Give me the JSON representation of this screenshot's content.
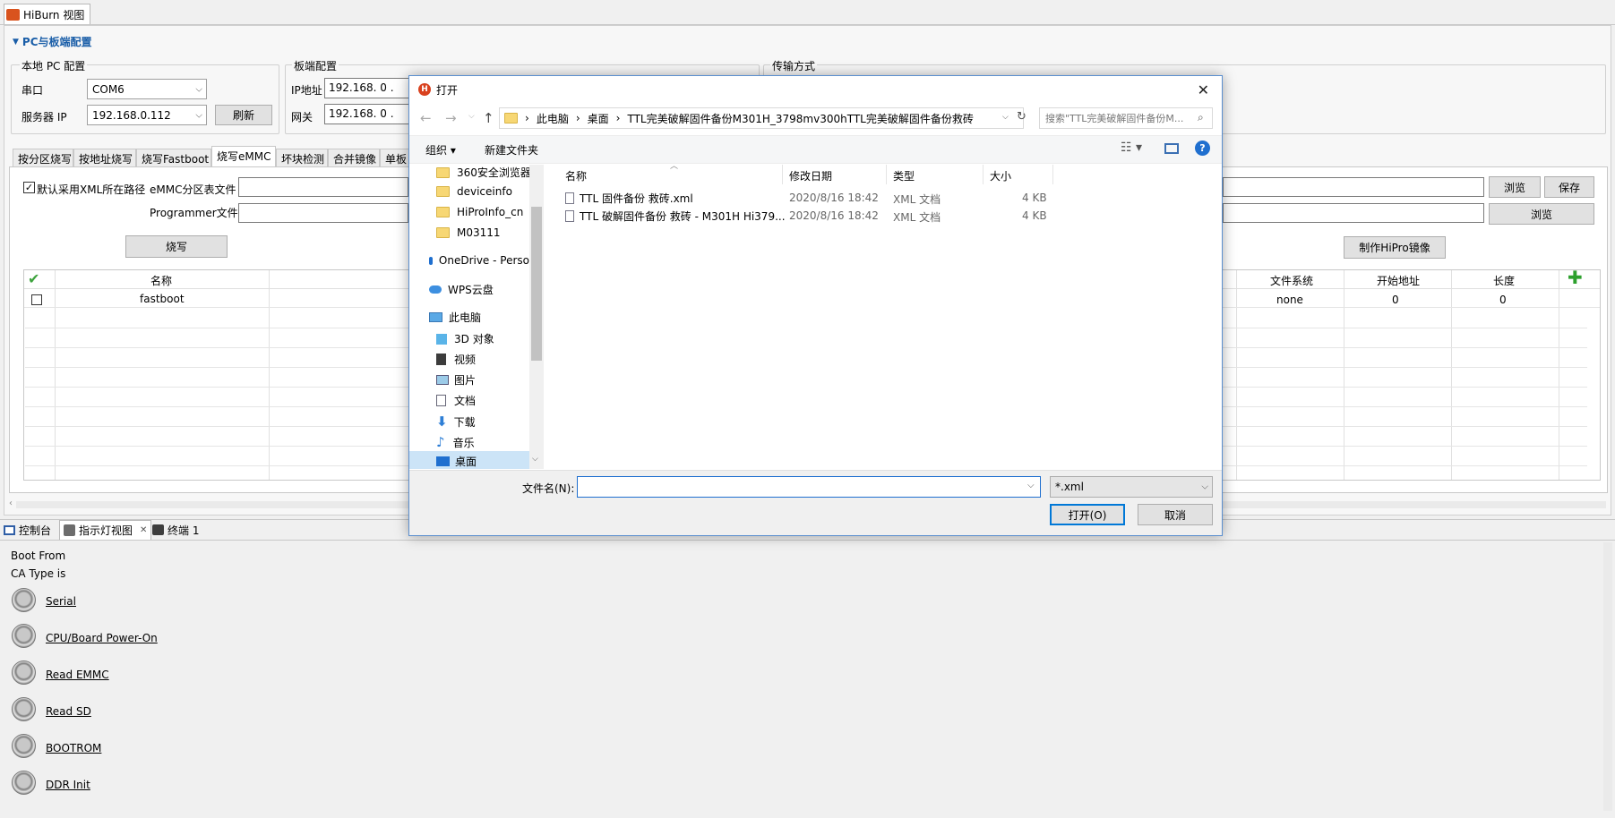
{
  "app": {
    "tab_title": "HiBurn 视图"
  },
  "section": {
    "title": "PC与板端配置"
  },
  "local_pc": {
    "title": "本地 PC 配置",
    "serial_label": "串口",
    "serial_value": "COM6",
    "server_ip_label": "服务器 IP",
    "server_ip_value": "192.168.0.112",
    "refresh": "刷新"
  },
  "board": {
    "title": "板端配置",
    "ip_label": "IP地址",
    "ip_value": "192.168. 0 .",
    "gateway_label": "网关",
    "gateway_value": "192.168. 0 ."
  },
  "transfer": {
    "title": "传输方式"
  },
  "tabs": [
    "按分区烧写",
    "按地址烧写",
    "烧写Fastboot",
    "烧写eMMC",
    "坏块检测",
    "合并镜像",
    "单板"
  ],
  "emmc": {
    "xml_checkbox_label": "默认采用XML所在路径",
    "partition_label": "eMMC分区表文件",
    "programmer_label": "Programmer文件",
    "browse1": "浏览",
    "save": "保存",
    "browse2": "浏览",
    "burn": "烧写",
    "make_image": "制作HiPro镜像"
  },
  "table": {
    "columns": {
      "name": "名称",
      "fs": "文件系统",
      "start": "开始地址",
      "length": "长度"
    },
    "rows": [
      {
        "name": "fastboot",
        "fs": "none",
        "start": "0",
        "length": "0"
      }
    ]
  },
  "bottom_tabs": [
    "控制台",
    "指示灯视图",
    "终端 1"
  ],
  "console": {
    "boot_from": "Boot From",
    "ca_type": "CA Type is",
    "leds": [
      "Serial",
      "CPU/Board Power-On",
      "Read EMMC",
      "Read SD",
      "BOOTROM",
      "DDR Init"
    ]
  },
  "dialog": {
    "title": "打开",
    "breadcrumb": [
      "此电脑",
      "桌面",
      "TTL完美破解固件备份M301H_3798mv300hTTL完美破解固件备份救砖"
    ],
    "search_placeholder": "搜索\"TTL完美破解固件备份M...",
    "organize": "组织 ▾",
    "new_folder": "新建文件夹",
    "nav": {
      "folders": [
        "360安全浏览器",
        "deviceinfo",
        "HiProInfo_cn",
        "M03111"
      ],
      "onedrive": "OneDrive - Perso",
      "wps": "WPS云盘",
      "thispc": "此电脑",
      "items": [
        "3D 对象",
        "视频",
        "图片",
        "文档",
        "下载",
        "音乐",
        "桌面"
      ]
    },
    "columns": {
      "name": "名称",
      "date": "修改日期",
      "type": "类型",
      "size": "大小"
    },
    "files": [
      {
        "name": "TTL 固件备份 救砖.xml",
        "date": "2020/8/16 18:42",
        "type": "XML 文档",
        "size": "4 KB"
      },
      {
        "name": "TTL 破解固件备份 救砖 - M301H Hi379...",
        "date": "2020/8/16 18:42",
        "type": "XML 文档",
        "size": "4 KB"
      }
    ],
    "filename_label": "文件名(N):",
    "filename_value": "",
    "filter": "*.xml",
    "open": "打开(O)",
    "cancel": "取消"
  }
}
